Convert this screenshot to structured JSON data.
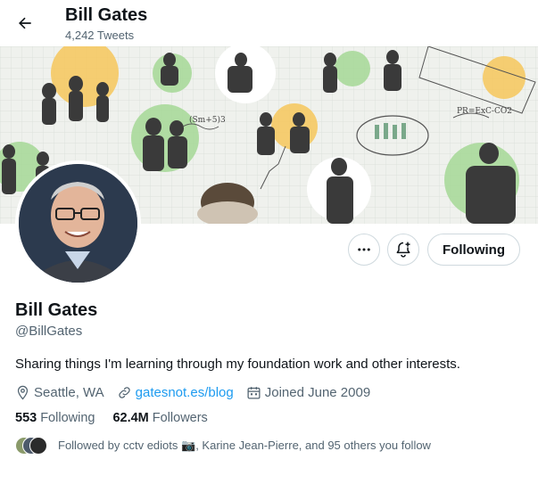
{
  "header": {
    "back_icon": "arrow-left-icon",
    "name": "Bill Gates",
    "tweet_count": "4,242 Tweets"
  },
  "banner": {
    "description_icon": "foundation-collage-banner"
  },
  "actions": {
    "more_icon": "more-dots-icon",
    "notify_icon": "bell-plus-icon",
    "following_label": "Following"
  },
  "profile": {
    "display_name": "Bill Gates",
    "handle": "@BillGates",
    "bio": "Sharing things I'm learning through my foundation work and other interests.",
    "location": "Seattle, WA",
    "website": "gatesnot.es/blog",
    "joined": "Joined June 2009"
  },
  "counts": {
    "following_num": "553",
    "following_label": "Following",
    "followers_num": "62.4M",
    "followers_label": "Followers"
  },
  "followed_by": {
    "text": "Followed by cctv ediots 📷, Karine Jean-Pierre, and 95 others you follow"
  },
  "colors": {
    "link": "#1d9bf0",
    "secondary_text": "#536471",
    "border": "#cfd9de"
  }
}
